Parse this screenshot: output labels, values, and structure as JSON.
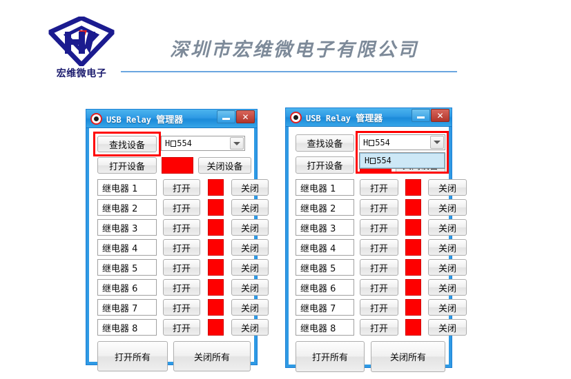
{
  "header": {
    "company_name": "深圳市宏维微电子有限公司",
    "logo_text": "宏维微电子",
    "logo_colors": {
      "blue": "#1b1b8f",
      "red": "#e02020"
    },
    "divider_color": "#6aa6e0"
  },
  "window": {
    "title_ascii": "USB Relay",
    "title_cjk": "管理器",
    "minimize_label": "",
    "close_label": "✕",
    "icon": "red-eye-icon"
  },
  "controls": {
    "find_device": "查找设备",
    "open_device": "打开设备",
    "close_device": "关闭设备",
    "device_value_prefix": "H",
    "device_value_suffix": "554",
    "open_all": "打开所有",
    "close_all": "关闭所有",
    "row_open": "打开",
    "row_close": "关闭",
    "led_color": "#fe0000",
    "highlight_color": "#cde8f6",
    "annotation_color": "#ff0000"
  },
  "relays": [
    {
      "label": "继电器 1"
    },
    {
      "label": "继电器 2"
    },
    {
      "label": "继电器 3"
    },
    {
      "label": "继电器 4"
    },
    {
      "label": "继电器 5"
    },
    {
      "label": "继电器 6"
    },
    {
      "label": "继电器 7"
    },
    {
      "label": "继电器 8"
    }
  ],
  "left_window": {
    "annotated_element": "find-device-button",
    "dropdown_open": false
  },
  "right_window": {
    "annotated_element": "device-combo-and-list",
    "dropdown_open": true,
    "selected_option": "H 554"
  }
}
